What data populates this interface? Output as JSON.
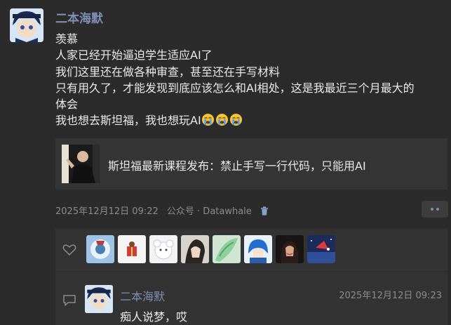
{
  "post": {
    "author": "二本海默",
    "lines": [
      "羡慕",
      "人家已经开始逼迫学生适应AI了",
      "我们这里还在做各种审查，甚至还在手写材料",
      "只有用久了，才能发现到底应该怎么和AI相处，这是我最近三个月最大的",
      "体会",
      "我也想去斯坦福，我也想玩AI"
    ],
    "emoji": [
      "crying-face",
      "crying-face",
      "crying-face"
    ],
    "card_title": "斯坦福最新课程发布：禁止手写一行代码，只能用AI",
    "date": "2025年12月12日 09:22",
    "source": "公众号 · Datawhale"
  },
  "likes": {
    "avatars": [
      "like-avatar-1",
      "like-avatar-2",
      "like-avatar-3",
      "like-avatar-4",
      "like-avatar-5",
      "like-avatar-6",
      "like-avatar-7",
      "like-avatar-8"
    ]
  },
  "comment": {
    "name": "二本海默",
    "time": "2025年12月12日 09:23",
    "text": "痴人说梦，哎"
  },
  "colors": {
    "background": "#2b2b2b",
    "name": "#7e8fb3",
    "meta": "#8c8c8c",
    "panel": "#333333"
  }
}
